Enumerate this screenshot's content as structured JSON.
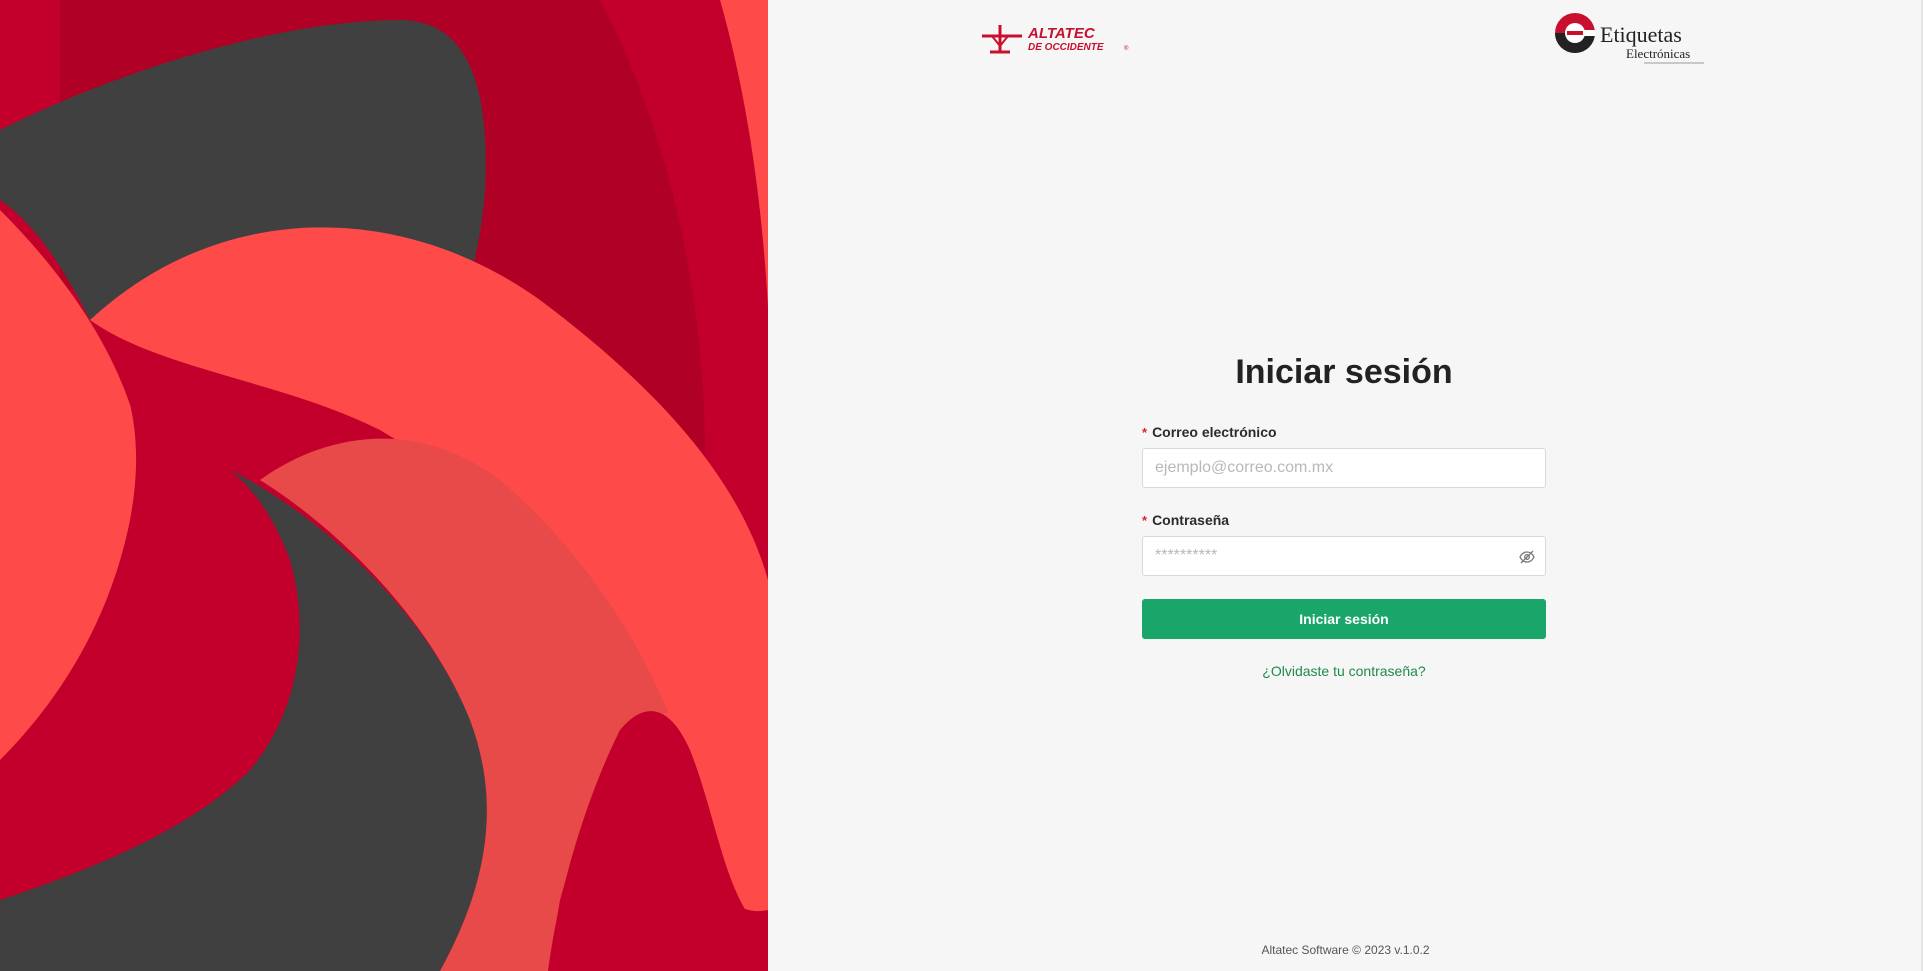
{
  "brand": {
    "altatec_line1": "ALTATEC",
    "altatec_line2": "DE OCCIDENTE",
    "altatec_mark": "®",
    "etiquetas_line1": "Etiquetas",
    "etiquetas_line2": "Electrónicas",
    "primary_red": "#c8102e",
    "accent_green": "#1aa66b"
  },
  "login": {
    "title": "Iniciar sesión",
    "email_label": "Correo electrónico",
    "email_placeholder": "ejemplo@correo.com.mx",
    "password_label": "Contraseña",
    "password_placeholder": "**********",
    "required_mark": "*",
    "submit_label": "Iniciar sesión",
    "forgot_link": "¿Olvidaste tu contraseña?",
    "password_toggle_icon": "eye-off-icon"
  },
  "footer": {
    "text": "Altatec Software © 2023 v.1.0.2"
  }
}
